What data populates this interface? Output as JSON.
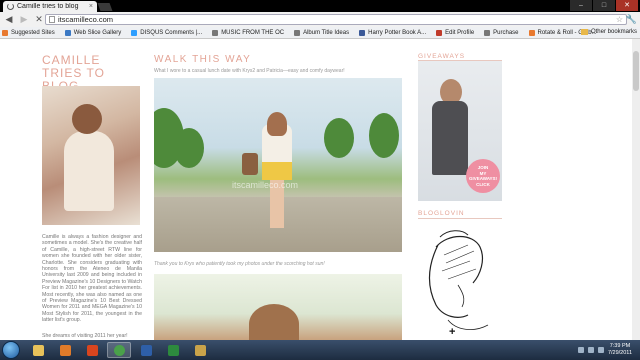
{
  "browser": {
    "tab_title": "Camille tries to blog",
    "tab_close": "×",
    "url": "itscamilleco.com",
    "nav": {
      "back": "◀",
      "forward": "▶",
      "stop": "✕"
    },
    "window_buttons": {
      "minimize": "–",
      "maximize": "□",
      "close": "✕"
    },
    "bookmarks": [
      {
        "label": "Suggested Sites",
        "color": "#e8792f"
      },
      {
        "label": "Web Slice Gallery",
        "color": "#3b79c4"
      },
      {
        "label": "DISQUS Comments |...",
        "color": "#2e9fff"
      },
      {
        "label": "MUSIC FROM THE OC",
        "color": "#777777"
      },
      {
        "label": "Album Title Ideas",
        "color": "#777777"
      },
      {
        "label": "Harry Potter Book A...",
        "color": "#3b5998"
      },
      {
        "label": "Edit Profile",
        "color": "#c03b2b"
      },
      {
        "label": "Purchase",
        "color": "#777777"
      },
      {
        "label": "Rotate & Roll - Grab...",
        "color": "#e8792f"
      }
    ],
    "other_bookmarks": "Other bookmarks"
  },
  "page": {
    "blog_title": "CAMILLE TRIES TO BLOG",
    "bio": "Camille is always a fashion designer and sometimes a model. She's the creative half of Camille, a high-street RTW line for women she founded with her older sister, Charlotte. She considers graduating with honors from the Ateneo de Manila University last 2009 and being included in Preview Magazine's 10 Designers to Watch For list in 2010 her greatest achievements. Most recently, she was also named as one of Preview Magazine's 10 Best Dressed Women for 2011 and MEGA Magazine's 10 Most Stylish for 2011, the youngest in the latter list's group.",
    "bio_continued": "She dreams of visiting 2011 her year!",
    "post": {
      "title": "WALK THIS WAY",
      "subtitle": "What I wore to a casual lunch date with Krys2 and Patricia—easy and comfy daywear!",
      "watermark": "itscamilleco.com",
      "caption": "Thank you to Krys who patiently took my photos under the scorching hot sun!"
    },
    "sidebar": {
      "giveaways_title": "GIVEAWAYS",
      "join_badge": [
        "JOIN",
        "MY",
        "GIVEAWAYS!",
        "CLICK"
      ],
      "bloglovin_title": "BLOGLOVIN"
    }
  },
  "taskbar": {
    "time": "7:39 PM",
    "date": "7/29/2011",
    "apps": [
      {
        "name": "folder",
        "color": "#e8c25a"
      },
      {
        "name": "media",
        "color": "#e07b2a"
      },
      {
        "name": "player",
        "color": "#d9451e"
      },
      {
        "name": "chrome",
        "color": "#4aa14a"
      },
      {
        "name": "word",
        "color": "#2e5fa8"
      },
      {
        "name": "excel",
        "color": "#2d8a3e"
      },
      {
        "name": "paint",
        "color": "#c9a34a"
      }
    ]
  }
}
